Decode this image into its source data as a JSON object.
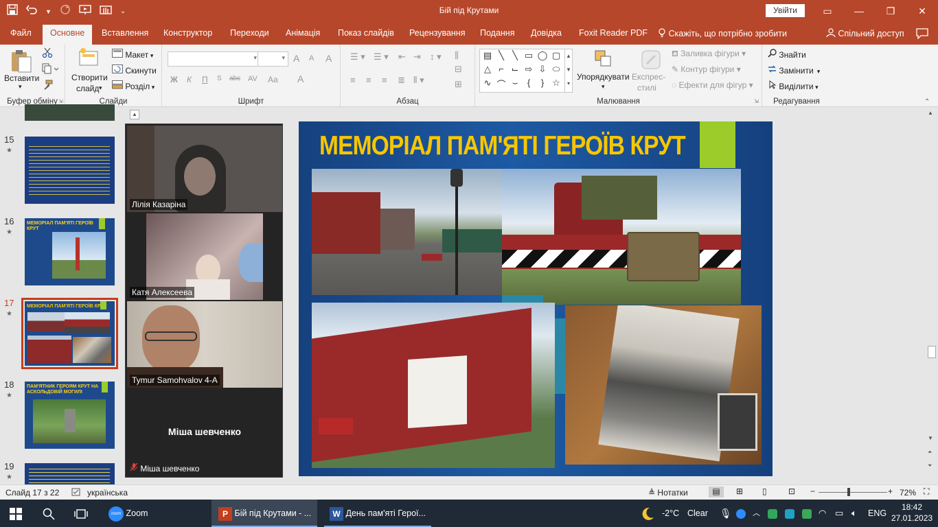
{
  "app": {
    "doc_title": "Бій під Крутами",
    "signin_label": "Увійти",
    "qat_icons": [
      "save-icon",
      "undo-icon",
      "redo-icon",
      "present-icon",
      "touch-mode-icon",
      "customize-qat-icon"
    ],
    "window_controls": {
      "ribbon_display": "▭",
      "minimize": "—",
      "restore": "❐",
      "close": "✕"
    }
  },
  "tabs": [
    {
      "label": "Файл"
    },
    {
      "label": "Основне"
    },
    {
      "label": "Вставлення"
    },
    {
      "label": "Конструктор"
    },
    {
      "label": "Переходи"
    },
    {
      "label": "Анімація"
    },
    {
      "label": "Показ слайдів"
    },
    {
      "label": "Рецензування"
    },
    {
      "label": "Подання"
    },
    {
      "label": "Довідка"
    },
    {
      "label": "Foxit Reader PDF"
    }
  ],
  "tell_me": "Скажіть, що потрібно зробити",
  "share": "Спільний доступ",
  "ribbon": {
    "clipboard": {
      "paste": "Вставити",
      "group": "Буфер обміну"
    },
    "slides": {
      "new_slide_1": "Створити",
      "new_slide_2": "слайд",
      "layout": "Макет",
      "reset": "Скинути",
      "section": "Розділ",
      "group": "Слайди"
    },
    "font": {
      "bold": "Ж",
      "italic": "К",
      "underline": "П",
      "strike": "abc",
      "spacing": "AV",
      "case": "Aa",
      "color": "A",
      "grow": "A",
      "shrink": "A",
      "clear": "A",
      "group": "Шрифт"
    },
    "paragraph": {
      "group": "Абзац"
    },
    "drawing": {
      "arrange_1": "Упорядкувати",
      "quick_styles_1": "Експрес-",
      "quick_styles_2": "стилі",
      "fill": "Заливка фігури",
      "outline": "Контур фігури",
      "effects": "Ефекти для фігур",
      "group": "Малювання"
    },
    "editing": {
      "find": "Знайти",
      "replace": "Замінити",
      "select": "Виділити",
      "group": "Редагування"
    }
  },
  "slides_panel": [
    {
      "num": "15",
      "title": "",
      "selected": false
    },
    {
      "num": "16",
      "title": "МЕМОРІАЛ ПАМ'ЯТІ ГЕРОЇВ КРУТ",
      "selected": false
    },
    {
      "num": "17",
      "title": "МЕМОРІАЛ ПАМ'ЯТІ ГЕРОЇВ КРУТ",
      "selected": true
    },
    {
      "num": "18",
      "title": "ПАМ'ЯТНИК ГЕРОЯМ КРУТ НА АСКОЛЬДОВІЙ МОГИЛІ",
      "selected": false
    },
    {
      "num": "19",
      "title": "",
      "selected": false
    }
  ],
  "zoom": {
    "participants": [
      {
        "name": "Лілія Казаріна"
      },
      {
        "name": "Катя Алексеева"
      },
      {
        "name": "Tymur Samohvalov 4-А"
      },
      {
        "name": "Міша шевченко",
        "center_name": "Міша шевченко",
        "muted": true
      }
    ]
  },
  "slide": {
    "title": "МЕМОРІАЛ ПАМ'ЯТІ ГЕРОЇВ КРУТ"
  },
  "status": {
    "slide_of": "Слайд 17 з 22",
    "language": "українська",
    "notes": "Нотатки",
    "zoom_minus": "−",
    "zoom_plus": "+",
    "zoom_level": "72%",
    "zoom_fraction": 0.44
  },
  "taskbar": {
    "apps": [
      {
        "label": "Zoom"
      },
      {
        "label": "Бій під Крутами - ..."
      },
      {
        "label": "День пам'яті Герої..."
      }
    ],
    "weather_temp": "-2°C",
    "weather_desc": "Clear",
    "lang": "ENG",
    "time": "18:42",
    "date": "27.01.2023"
  },
  "colors": {
    "accent": "#b7472a",
    "slide_bg": "#1d5aa3",
    "title_yellow": "#f7c600",
    "green": "#9ccc2a",
    "selection": "#c43e1c"
  }
}
